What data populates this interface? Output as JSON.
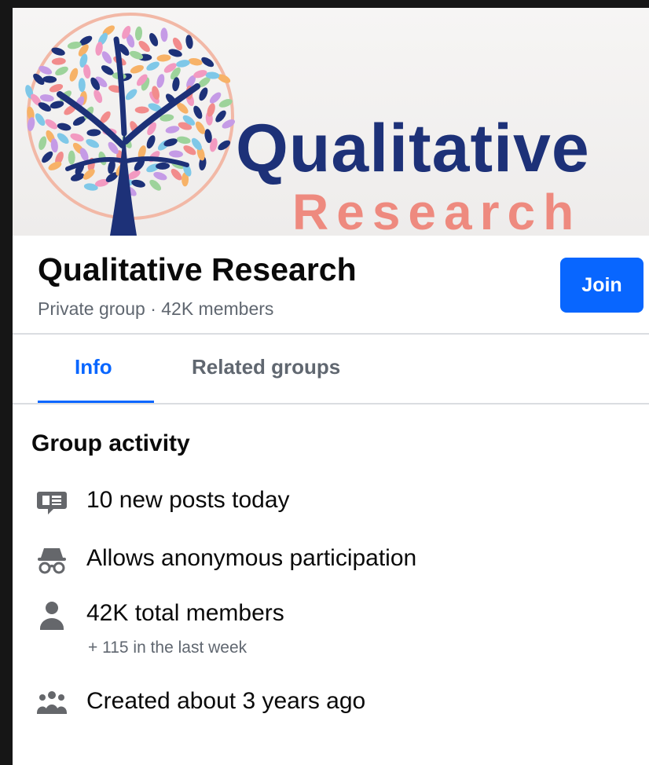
{
  "cover": {
    "title": "Qualitative",
    "subtitle": "Research",
    "colors": {
      "navy": "#1d3178",
      "coral": "#ee8a7f"
    }
  },
  "header": {
    "group_name": "Qualitative Research",
    "meta": "Private group · 42K members",
    "join_label": "Join"
  },
  "tabs": [
    {
      "label": "Info",
      "active": true
    },
    {
      "label": "Related groups",
      "active": false
    }
  ],
  "activity": {
    "title": "Group activity",
    "items": [
      {
        "icon": "posts-icon",
        "text": "10 new posts today"
      },
      {
        "icon": "anonymous-icon",
        "text": "Allows anonymous participation"
      },
      {
        "icon": "person-icon",
        "text": "42K total members",
        "sub": "+ 115 in the last week"
      },
      {
        "icon": "group-icon",
        "text": "Created about 3 years ago"
      }
    ]
  },
  "colors": {
    "accent": "#0866ff",
    "secondary_text": "#606770",
    "divider": "#dadde1"
  }
}
